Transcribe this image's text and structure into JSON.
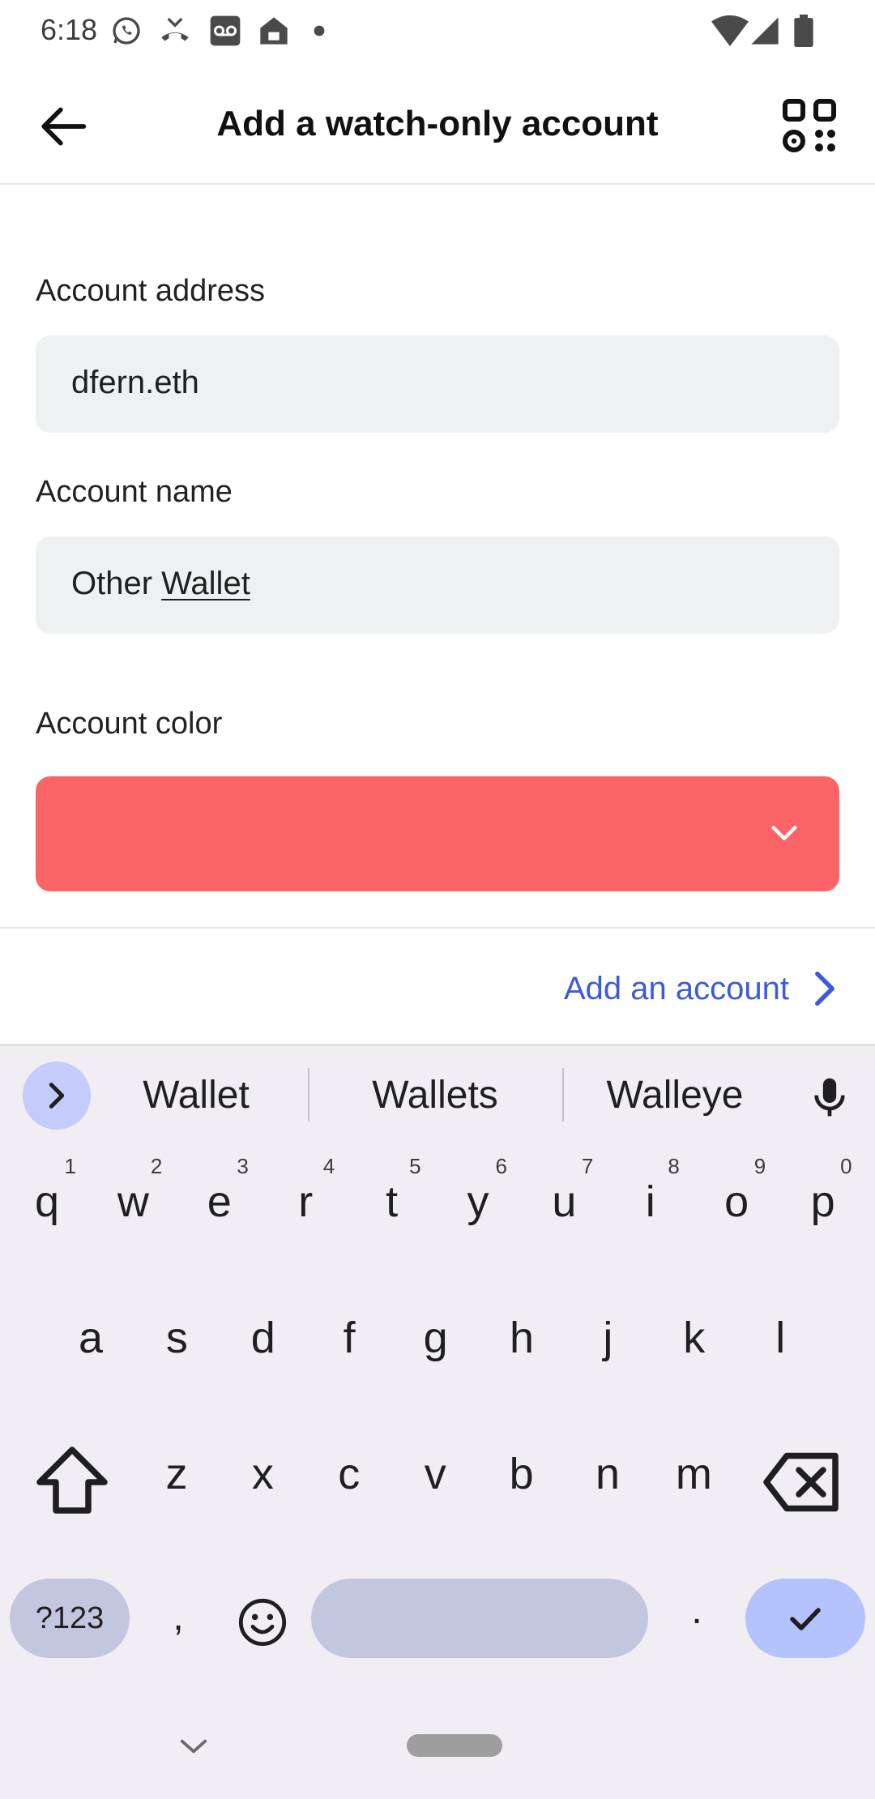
{
  "status_bar": {
    "time": "6:18",
    "left_icons": [
      "whatsapp-icon",
      "missed-call-icon",
      "voicemail-icon",
      "home-icon",
      "dot-icon"
    ],
    "right_icons": [
      "wifi-icon",
      "signal-icon",
      "battery-icon"
    ]
  },
  "header": {
    "title": "Add a watch-only account",
    "back_icon": "arrow-left-icon",
    "scan_icon": "qr-code-icon"
  },
  "form": {
    "address_label": "Account address",
    "address_value": "dfern.eth",
    "name_label": "Account name",
    "name_value_prefix": "Other ",
    "name_value_composing": "Wallet",
    "color_label": "Account color",
    "selected_color": "#fb6467"
  },
  "footer": {
    "add_account_label": "Add an account",
    "accent_color": "#3d5ad8"
  },
  "keyboard": {
    "suggestions": [
      "Wallet",
      "Wallets",
      "Walleye"
    ],
    "row1": [
      {
        "ch": "q",
        "hint": "1"
      },
      {
        "ch": "w",
        "hint": "2"
      },
      {
        "ch": "e",
        "hint": "3"
      },
      {
        "ch": "r",
        "hint": "4"
      },
      {
        "ch": "t",
        "hint": "5"
      },
      {
        "ch": "y",
        "hint": "6"
      },
      {
        "ch": "u",
        "hint": "7"
      },
      {
        "ch": "i",
        "hint": "8"
      },
      {
        "ch": "o",
        "hint": "9"
      },
      {
        "ch": "p",
        "hint": "0"
      }
    ],
    "row2": [
      "a",
      "s",
      "d",
      "f",
      "g",
      "h",
      "j",
      "k",
      "l"
    ],
    "row3": [
      "z",
      "x",
      "c",
      "v",
      "b",
      "n",
      "m"
    ],
    "symbols_label": "?123",
    "comma": ",",
    "period": "."
  }
}
